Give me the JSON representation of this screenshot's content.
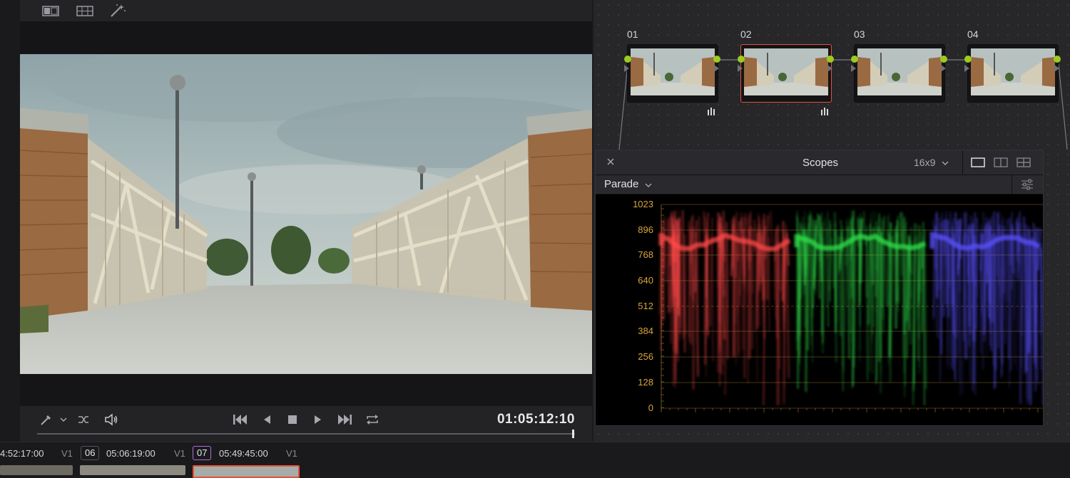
{
  "viewer": {
    "timecode": "01:05:12:10",
    "playhead_fraction": 1.0
  },
  "nodes": [
    {
      "number": "01",
      "selected": false,
      "has_bars": true
    },
    {
      "number": "02",
      "selected": true,
      "has_bars": true
    },
    {
      "number": "03",
      "selected": false,
      "has_bars": false
    },
    {
      "number": "04",
      "selected": false,
      "has_bars": false
    }
  ],
  "scopes": {
    "title": "Scopes",
    "aspect": "16x9",
    "mode": "Parade",
    "close_icon": "close-icon",
    "layout_icons": [
      "single-view-icon",
      "dual-view-icon",
      "quad-view-icon"
    ],
    "settings_icon": "settings-sliders-icon",
    "scale": [
      "1023",
      "896",
      "768",
      "640",
      "512",
      "384",
      "256",
      "128",
      "0"
    ],
    "scale_color": "#d9a63a",
    "channel_colors": [
      "#ff4848",
      "#2fe24a",
      "#5a52ff"
    ]
  },
  "timeline": {
    "prev_tc": "4:52:17:00",
    "prev_track": "V1",
    "clip_06": "06",
    "clip_06_tc": "05:06:19:00",
    "clip_06_track": "V1",
    "clip_07": "07",
    "clip_07_tc": "05:49:45:00",
    "clip_07_track": "V1"
  },
  "colors": {
    "node_connector": "#9ccc1e",
    "selected_node": "#e0533d",
    "active_clip": "#b46be0"
  }
}
